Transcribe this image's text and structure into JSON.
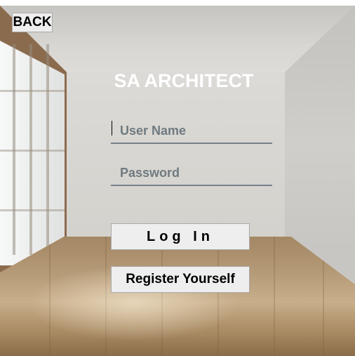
{
  "header": {
    "back_label": "BACK"
  },
  "login_form": {
    "title": "SA ARCHITECT",
    "username_placeholder": "User Name",
    "password_placeholder": "Password",
    "login_label": "Log In",
    "register_label": "Register Yourself"
  },
  "colors": {
    "title_text": "#ffffff",
    "button_background": "#eeeeee",
    "field_underline": "#76818b"
  }
}
